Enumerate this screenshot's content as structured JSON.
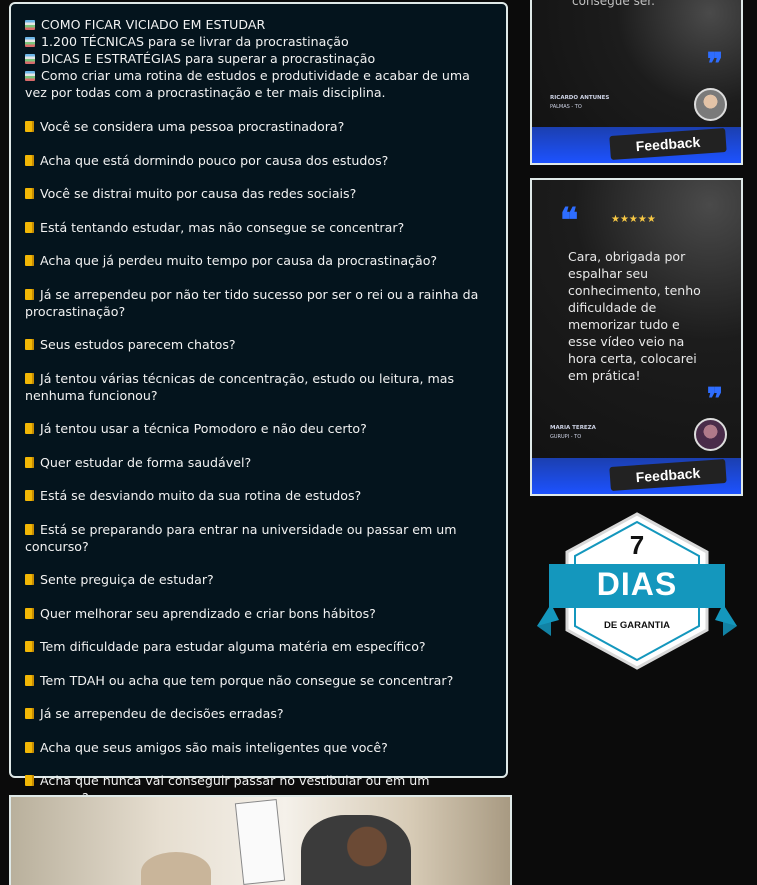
{
  "intro": [
    "COMO FICAR VICIADO EM ESTUDAR",
    "1.200 TÉCNICAS para se livrar da procrastinação",
    "DICAS E ESTRATÉGIAS para superar a procrastinação",
    "Como criar uma rotina de estudos e produtividade e acabar de uma vez por todas com a procrastinação e ter mais disciplina."
  ],
  "questions": [
    "Você se considera uma pessoa procrastinadora?",
    "Acha que está dormindo pouco por causa dos estudos?",
    "Você se distrai muito por causa das redes sociais?",
    "Está tentando estudar, mas não consegue se concentrar?",
    "Acha que já perdeu muito tempo por causa da procrastinação?",
    "Já se arrependeu por não ter tido sucesso por ser o rei ou a rainha da procrastinação?",
    "Seus estudos parecem chatos?",
    "Já tentou várias técnicas de concentração, estudo ou leitura, mas nenhuma funcionou?",
    "Já tentou usar a técnica Pomodoro e não deu certo?",
    "Quer estudar de forma saudável?",
    "Está se desviando muito da sua rotina de estudos?",
    "Está se preparando para entrar na universidade ou passar em um concurso?",
    "Sente preguiça de estudar?",
    "Quer melhorar seu aprendizado e criar bons hábitos?",
    "Tem dificuldade para estudar alguma matéria em específico?",
    "Tem TDAH ou acha que tem porque não consegue se concentrar?",
    "Já se arrependeu de decisões erradas?",
    "Acha que seus amigos são mais inteligentes que você?",
    "Acha que nunca vai conseguir passar no vestibular ou em um concurso?"
  ],
  "testimonials": [
    {
      "faded_text": "consegue ser.",
      "author": "RICARDO ANTUNES",
      "city": "PALMAS - TO",
      "feedback_label": "Feedback"
    },
    {
      "stars": "★★★★★",
      "text": "Cara, obrigada por espalhar seu conhecimento, tenho dificuldade de memorizar tudo e esse vídeo veio na hora certa, colocarei em prática!",
      "author": "MARIA TEREZA",
      "city": "GURUPI - TO",
      "feedback_label": "Feedback"
    }
  ],
  "guarantee": {
    "number": "7",
    "word": "DIAS",
    "label": "DE GARANTIA"
  },
  "colors": {
    "panel_bg": "#04141d",
    "panel_border": "#dfe9e8",
    "accent_blue": "#1d52ff",
    "ribbon": "#1497bd",
    "question_icon": "#f2b705"
  },
  "icons": {
    "intro": "books-icon",
    "question": "notebook-icon"
  }
}
